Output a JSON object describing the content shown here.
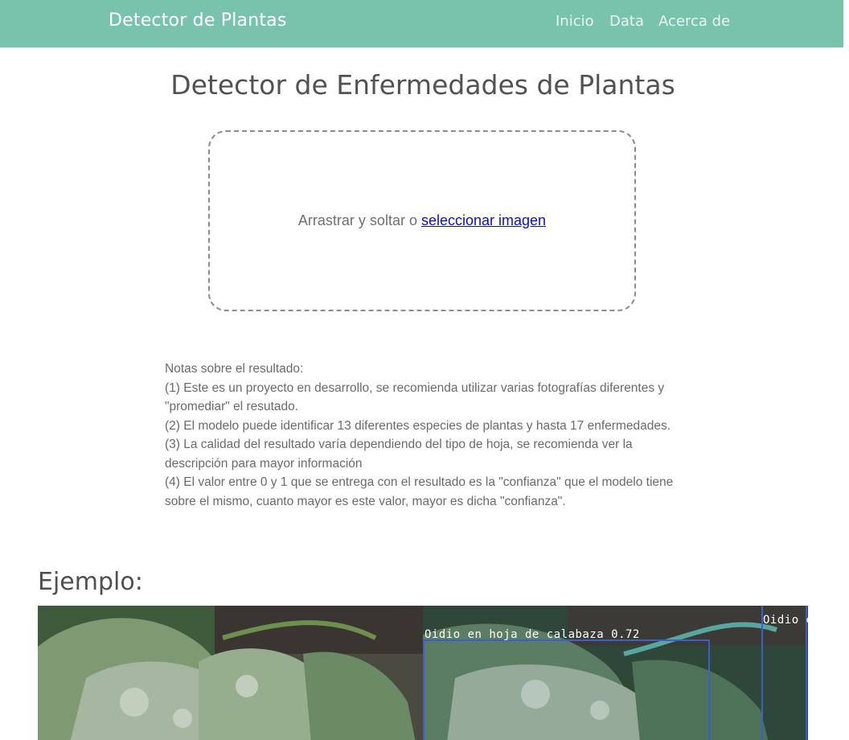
{
  "navbar": {
    "brand": "Detector de Plantas",
    "links": [
      "Inicio",
      "Data",
      "Acerca de"
    ],
    "background": "#79c3ac"
  },
  "page_title": "Detector de Enfermedades de Plantas",
  "upload": {
    "prompt": "Arrastrar y soltar o",
    "link_label": "seleccionar imagen"
  },
  "notes": {
    "heading": "Notas sobre el resultado:",
    "items": [
      "(1) Este es un proyecto en desarrollo, se recomienda utilizar varias fotografías diferentes y \"promediar\" el resutado.",
      "(2) El modelo puede identificar 13 diferentes especies de plantas y hasta 17 enfermedades.",
      "(3) La calidad del resultado varía dependiendo del tipo de hoja, se recomienda ver la descripción para mayor información",
      "(4) El valor entre 0 y 1 que se entrega con el resultado es la \"confianza\" que el modelo tiene sobre el mismo, cuanto mayor es este valor, mayor es dicha \"confianza\"."
    ]
  },
  "example": {
    "heading": "Ejemplo:",
    "detection_labels": [
      "Oidio en hoja de calabaza 0.72",
      "Oidio en"
    ],
    "box_color": "#3b5fd0"
  }
}
